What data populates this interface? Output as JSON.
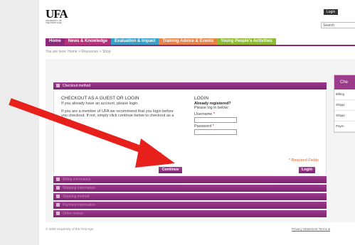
{
  "header": {
    "logo_text": "UFA",
    "logo_sub": "UNIVERSITY OF THE FIRST AGE",
    "login_link": "Login",
    "search_placeholder": "Search"
  },
  "nav": [
    {
      "label": "Home",
      "color": "#8b2a7a"
    },
    {
      "label": "News & Knowledge",
      "color": "#b7327a"
    },
    {
      "label": "Evaluation & Impact",
      "color": "#3aa0c8"
    },
    {
      "label": "Training Advice & Events",
      "color": "#e8844a"
    },
    {
      "label": "Young People's Activities",
      "color": "#8cbd2e"
    }
  ],
  "breadcrumb": "You are here: Home > Resources > Shop",
  "checkout": {
    "section_title": "Checkout method",
    "guest_heading": "CHECKOUT AS A GUEST OR LOGIN",
    "guest_line1": "If you already have an account, please login.",
    "guest_line2": "If you are a member of UFA we recommend that you login before you checkout. If not, simply click continue below to checkout as a guest.",
    "continue_button": "Continue",
    "login_heading": "LOGIN",
    "already_registered": "Already registered?",
    "login_hint": "Please log in below:",
    "username_label": "Username",
    "password_label": "Password",
    "required_marker": "*",
    "required_note": "* Required Fields",
    "login_button": "Login",
    "steps": [
      "Billing information",
      "Shipping information",
      "Shipping method",
      "Payment information",
      "Order review"
    ]
  },
  "sidebar": {
    "heading": "Che",
    "rows": [
      "Billing",
      "Shippi",
      "Shippi",
      "Paym"
    ]
  },
  "footer": {
    "copyright": "© 2009 University of the First Age",
    "links": "Privacy Statement  Terms &"
  },
  "annotation": {
    "arrow_color": "#e8201c"
  }
}
